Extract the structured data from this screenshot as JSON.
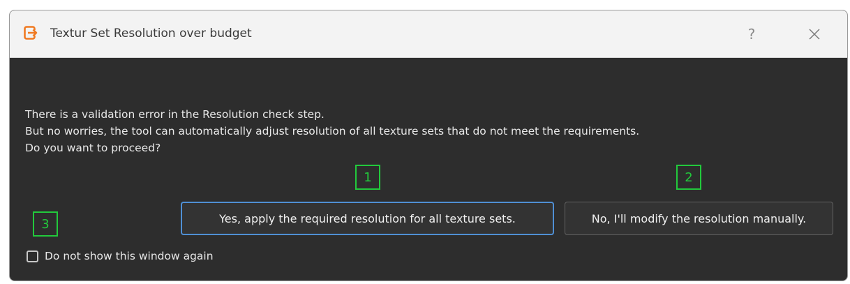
{
  "dialog": {
    "title": "Textur Set Resolution over budget",
    "help_label": "?",
    "message_lines": [
      "There is a validation error in the Resolution check step.",
      "But no worries, the tool can automatically adjust resolution of all texture sets that do not meet the requirements.",
      "Do you want to proceed?"
    ],
    "yes_button_label": "Yes, apply the required resolution for all texture sets.",
    "no_button_label": "No, I'll modify the resolution manually.",
    "checkbox_label": "Do not show this window again",
    "checkbox_checked": false
  },
  "annotations": [
    {
      "label": "1",
      "target": "yes-button"
    },
    {
      "label": "2",
      "target": "no-button"
    },
    {
      "label": "3",
      "target": "do-not-show-checkbox"
    }
  ],
  "colors": {
    "dialog_background": "#2d2d2d",
    "titlebar_background": "#f3f3f3",
    "accent_border": "#4f8fd4",
    "annotation_green": "#22c93c",
    "app_icon_orange": "#f07a22"
  },
  "icons": {
    "app": "export-arrow-icon",
    "close": "close-icon"
  }
}
